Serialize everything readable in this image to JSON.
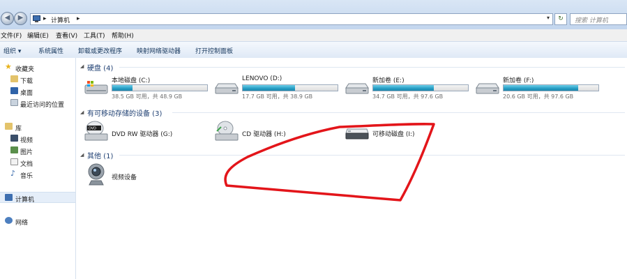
{
  "address": {
    "crumbs": [
      "计算机"
    ],
    "search_placeholder": "搜索 计算机"
  },
  "menu": [
    "文件(F)",
    "编辑(E)",
    "查看(V)",
    "工具(T)",
    "帮助(H)"
  ],
  "toolbar": [
    "组织 ▾",
    "系统属性",
    "卸载或更改程序",
    "映射网络驱动器",
    "打开控制面板"
  ],
  "nav": {
    "favorites": "收藏夹",
    "downloads": "下载",
    "desktop": "桌面",
    "recent": "最近访问的位置",
    "libraries": "库",
    "videos": "视频",
    "pictures": "图片",
    "documents": "文档",
    "music": "音乐",
    "computer": "计算机",
    "network": "网络"
  },
  "groups": {
    "hdd": "硬盘 (4)",
    "removable": "有可移动存储的设备 (3)",
    "other": "其他 (1)"
  },
  "drives": [
    {
      "name": "本地磁盘 (C:)",
      "size": "38.5 GB 可用，共 48.9 GB",
      "used_fraction": 0.21
    },
    {
      "name": "LENOVO (D:)",
      "size": "17.7 GB 可用，共 38.9 GB",
      "used_fraction": 0.55
    },
    {
      "name": "新加卷 (E:)",
      "size": "34.7 GB 可用，共 97.6 GB",
      "used_fraction": 0.64
    },
    {
      "name": "新加卷 (F:)",
      "size": "20.6 GB 可用，共 97.6 GB",
      "used_fraction": 0.79
    }
  ],
  "devices": [
    {
      "name": "DVD RW 驱动器 (G:)"
    },
    {
      "name": "CD 驱动器 (H:)"
    },
    {
      "name": "可移动磁盘 (I:)"
    }
  ],
  "other_devices": [
    {
      "name": "视频设备"
    }
  ],
  "colors": {
    "annotation": "#e3151a",
    "bar_fill": "#2aa0c6",
    "group_title": "#1e3f72"
  }
}
